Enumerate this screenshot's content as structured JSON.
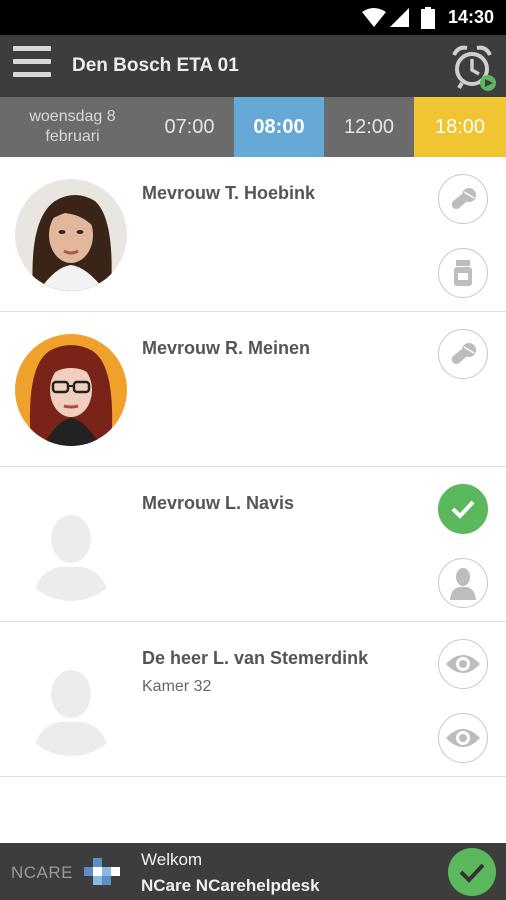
{
  "status_bar": {
    "time": "14:30",
    "icons": [
      "wifi-icon",
      "signal-icon",
      "battery-icon"
    ]
  },
  "app_bar": {
    "title": "Den Bosch ETA 01",
    "menu_icon": "hamburger-menu-icon",
    "alarm_icon": "alarm-clock-icon"
  },
  "time_bar": {
    "date_line1": "woensdag 8",
    "date_line2": "februari",
    "slots": [
      {
        "label": "07:00",
        "state": "default"
      },
      {
        "label": "08:00",
        "state": "selected",
        "color": "#67a9d6"
      },
      {
        "label": "12:00",
        "state": "default"
      },
      {
        "label": "18:00",
        "state": "highlight",
        "color": "#f1c531"
      }
    ]
  },
  "clients": [
    {
      "name": "Mevrouw T. Hoebink",
      "subtitle": "",
      "avatar": "photo",
      "actions": [
        "pills-icon",
        "medicine-bottle-icon"
      ]
    },
    {
      "name": "Mevrouw R. Meinen",
      "subtitle": "",
      "avatar": "photo",
      "actions": [
        "pills-icon"
      ]
    },
    {
      "name": "Mevrouw L. Navis",
      "subtitle": "",
      "avatar": "placeholder",
      "actions": [
        "check-icon",
        "person-icon"
      ]
    },
    {
      "name": "De heer L. van Stemerdink",
      "subtitle": "Kamer 32",
      "avatar": "placeholder",
      "actions": [
        "eye-icon",
        "eye-icon"
      ]
    }
  ],
  "footer": {
    "logo_text": "NCARE",
    "welcome": "Welkom",
    "user": "NCare NCarehelpdesk",
    "confirm_icon": "check-icon",
    "colors": {
      "accent_green": "#5cb85c"
    }
  }
}
